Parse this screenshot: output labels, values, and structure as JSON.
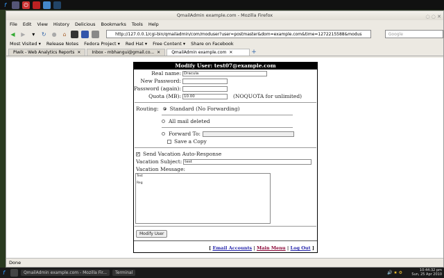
{
  "window": {
    "title": "QmailAdmin example.com - Mozilla Firefox"
  },
  "menu": [
    "File",
    "Edit",
    "View",
    "History",
    "Delicious",
    "Bookmarks",
    "Tools",
    "Help"
  ],
  "url": "http://127.0.0.1/cgi-bin/qmailadmin/com/moduser?user=postmaster&dom=example.com&time=1272215588&modus",
  "search_placeholder": "Google",
  "bookmarks": [
    "Most Visited ▾",
    "Release Notes",
    "Fedora Project ▾",
    "Red Hat ▾",
    "Free Content ▾",
    "Share on Facebook"
  ],
  "tabs": [
    "Piwik - Web Analytics Reports",
    "Inbox - mbhangui@gmail.co...",
    "QmailAdmin example.com"
  ],
  "form": {
    "title": "Modify User: test07@example.com",
    "real_name_label": "Real name:",
    "real_name": "Dracula",
    "new_password_label": "New Password:",
    "password_again_label": "Password (again):",
    "quota_label": "Quota (MB):",
    "quota": "10.00",
    "quota_note": "(NOQUOTA for unlimited)",
    "routing_label": "Routing:",
    "routing_standard": "Standard (No Forwarding)",
    "routing_deleted": "All mail deleted",
    "routing_forward": "Forward To:",
    "save_copy": "Save a Copy",
    "vacation_label": "Send Vacation Auto-Response",
    "vacation_subject_label": "Vacation Subject:",
    "vacation_subject": "test",
    "vacation_message_label": "Vacation Message:",
    "vacation_message": "Test\n\nReg",
    "submit": "Modify User"
  },
  "footer": {
    "email_accounts": "Email Accounts",
    "main_menu": "Main Menu",
    "log_out": "Log Out"
  },
  "status": "Done",
  "taskbar": {
    "items": [
      "QmailAdmin example.com - Mozilla Fir...",
      "Terminal"
    ],
    "time": "10:44:32 pm",
    "date": "Sun, 25 Apr 2010"
  }
}
